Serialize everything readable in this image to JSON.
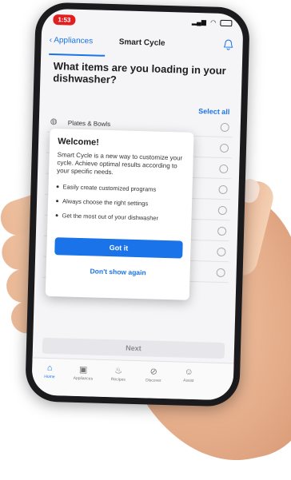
{
  "status_bar": {
    "time": "1:53"
  },
  "nav": {
    "back_label": "Appliances",
    "title": "Smart Cycle"
  },
  "question": "What items are you loading in your dishwasher?",
  "select_all": "Select all",
  "list": [
    {
      "label": "Plates & Bowls",
      "icon": "plate-icon"
    }
  ],
  "modal": {
    "title": "Welcome!",
    "description": "Smart Cycle is a new way to customize your cycle. Achieve optimal results according to your specific needs.",
    "bullets": [
      "Easily create customized programs",
      "Always choose the right settings",
      "Get the most out of your dishwasher"
    ],
    "primary_button": "Got it",
    "secondary_link": "Don't show again"
  },
  "next_button": "Next",
  "tabs": [
    {
      "label": "Home",
      "icon": "home-icon",
      "active": true
    },
    {
      "label": "Appliances",
      "icon": "appliance-icon",
      "active": false
    },
    {
      "label": "Recipes",
      "icon": "chef-hat-icon",
      "active": false
    },
    {
      "label": "Discover",
      "icon": "compass-icon",
      "active": false
    },
    {
      "label": "Assist",
      "icon": "assist-icon",
      "active": false
    }
  ],
  "colors": {
    "accent": "#1a73e8",
    "time_badge": "#e02020"
  }
}
